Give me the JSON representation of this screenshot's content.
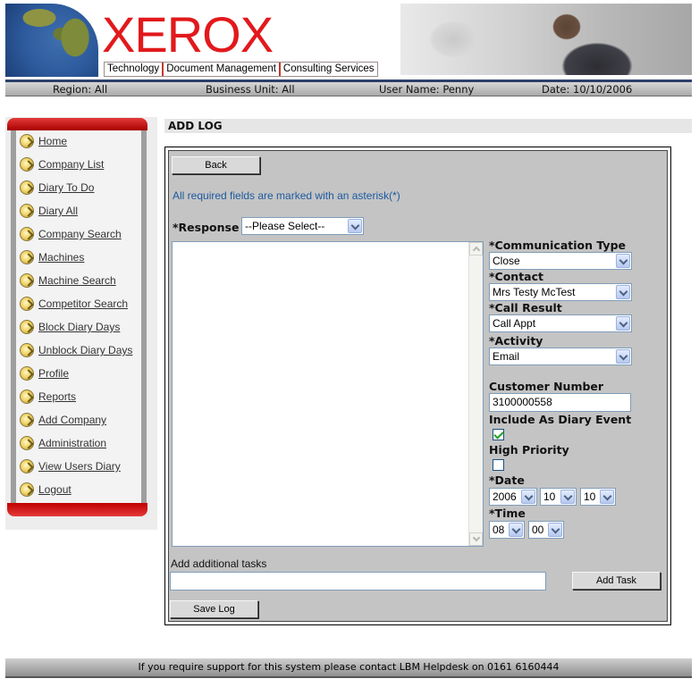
{
  "header": {
    "logo": "XEROX",
    "tagline": [
      "Technology",
      "Document Management",
      "Consulting Services"
    ]
  },
  "infobar": {
    "region": "Region: All",
    "business_unit": "Business Unit: All",
    "user": "User Name: Penny",
    "date": "Date: 10/10/2006"
  },
  "sidebar": {
    "items": [
      {
        "label": "Home"
      },
      {
        "label": "Company List"
      },
      {
        "label": "Diary To Do"
      },
      {
        "label": "Diary All"
      },
      {
        "label": "Company Search"
      },
      {
        "label": "Machines"
      },
      {
        "label": "Machine Search"
      },
      {
        "label": "Competitor Search"
      },
      {
        "label": "Block Diary Days"
      },
      {
        "label": "Unblock Diary Days"
      },
      {
        "label": "Profile"
      },
      {
        "label": "Reports"
      },
      {
        "label": "Add Company"
      },
      {
        "label": "Administration"
      },
      {
        "label": "View Users Diary"
      },
      {
        "label": "Logout"
      }
    ]
  },
  "main": {
    "title": "ADD LOG",
    "back_label": "Back",
    "required_note": "All required fields are marked with an asterisk(*)",
    "response": {
      "label": "*Response",
      "value": "--Please Select--"
    },
    "communication_type": {
      "label": "*Communication Type",
      "value": "Close"
    },
    "contact": {
      "label": "*Contact",
      "value": "Mrs Testy McTest"
    },
    "call_result": {
      "label": "*Call Result",
      "value": "Call Appt"
    },
    "activity": {
      "label": "*Activity",
      "value": "Email"
    },
    "customer_number": {
      "label": "Customer Number",
      "value": "3100000558"
    },
    "include_diary": {
      "label": "Include As Diary Event",
      "checked": true
    },
    "high_priority": {
      "label": "High Priority",
      "checked": false
    },
    "date": {
      "label": "*Date",
      "year": "2006",
      "month": "10",
      "day": "10"
    },
    "time": {
      "label": "*Time",
      "hour": "08",
      "minute": "00"
    },
    "tasks": {
      "label": "Add additional tasks",
      "value": "",
      "add_label": "Add Task"
    },
    "save_label": "Save Log"
  },
  "footer": {
    "text": "If you require support for this system please contact LBM Helpdesk on 0161 6160444"
  }
}
